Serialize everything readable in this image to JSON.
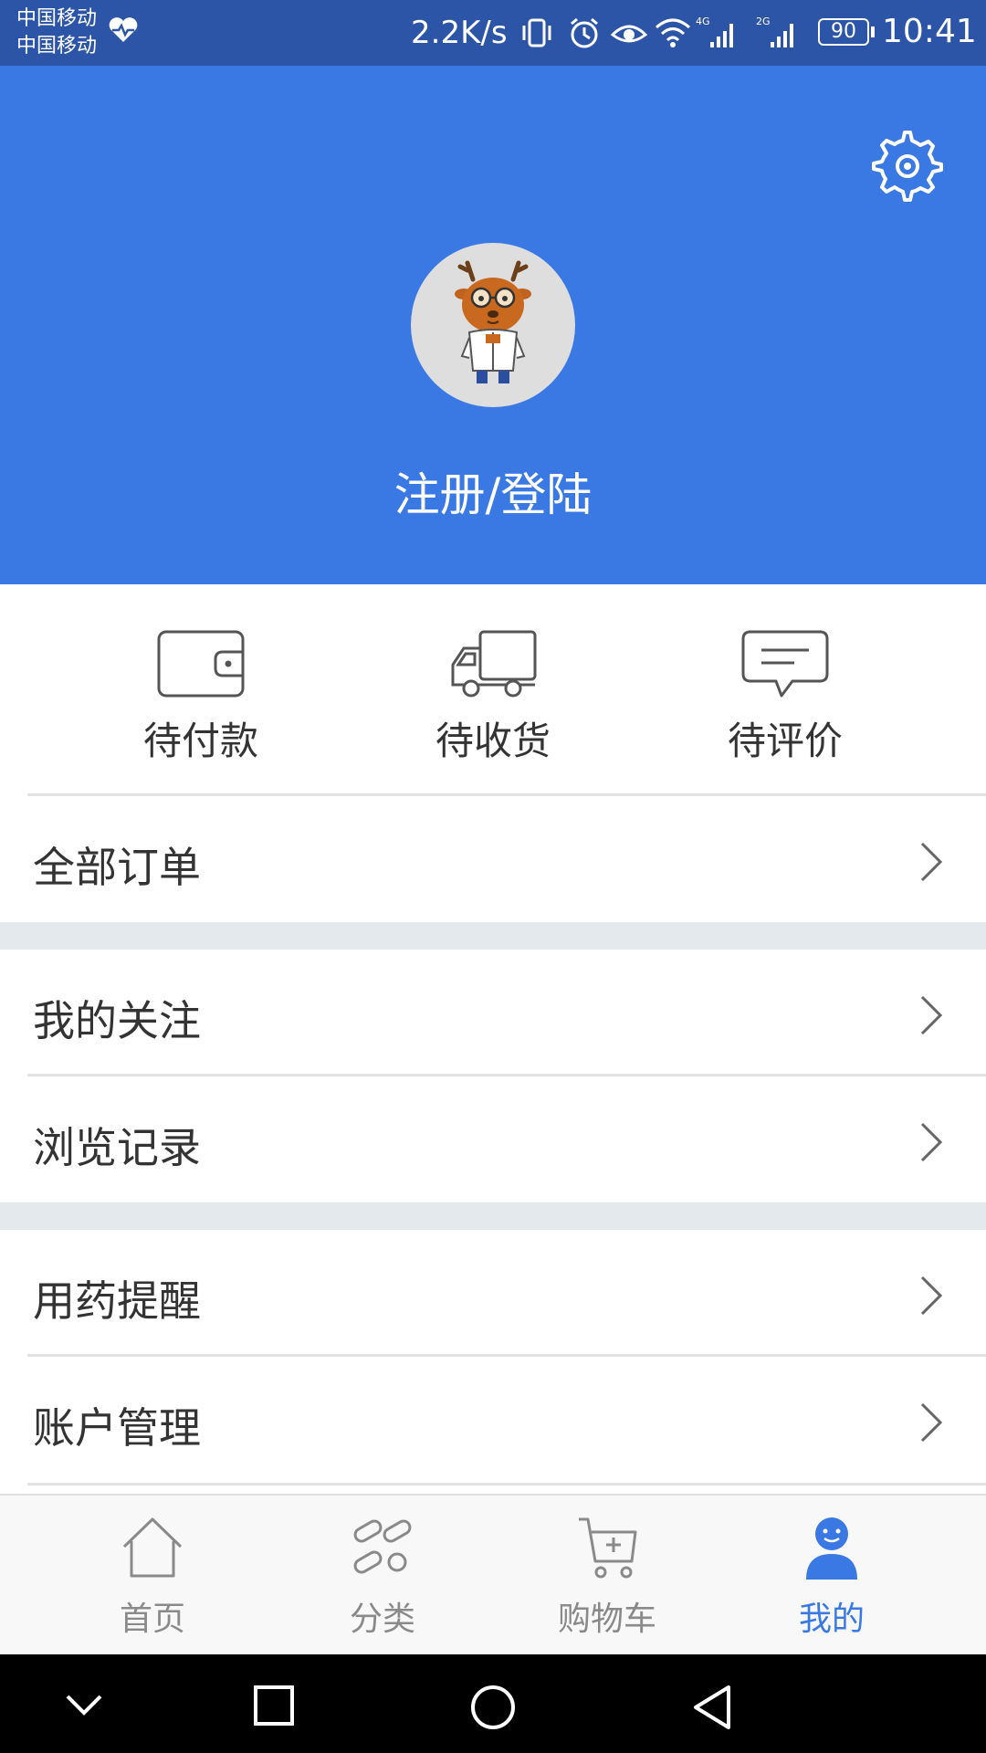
{
  "status_bar": {
    "carrier_1": "中国移动",
    "carrier_2": "中国移动",
    "net_speed": "2.2K/s",
    "battery": "90",
    "time": "10:41",
    "icons": [
      "health-icon",
      "vibrate-icon",
      "alarm-icon",
      "eye-icon",
      "wifi-icon",
      "signal-4g-icon",
      "signal-2g-icon",
      "battery-icon"
    ]
  },
  "header": {
    "background_color": "#3a79e4",
    "login_label": "注册/登陆",
    "icons": [
      "settings-icon",
      "avatar-deer-icon"
    ]
  },
  "orders": {
    "items": [
      {
        "label": "待付款",
        "icon": "wallet-icon"
      },
      {
        "label": "待收货",
        "icon": "truck-icon"
      },
      {
        "label": "待评价",
        "icon": "comment-icon"
      }
    ]
  },
  "menu": {
    "all_orders": "全部订单",
    "my_follows": "我的关注",
    "browse_history": "浏览记录",
    "medication_reminder": "用药提醒",
    "account_management": "账户管理"
  },
  "bottom_nav": {
    "active_color": "#3a79e4",
    "items": [
      {
        "label": "首页",
        "icon": "home-icon"
      },
      {
        "label": "分类",
        "icon": "category-icon"
      },
      {
        "label": "购物车",
        "icon": "cart-icon"
      },
      {
        "label": "我的",
        "icon": "profile-icon",
        "active": true
      }
    ]
  },
  "system_nav": {
    "icons": [
      "collapse-icon",
      "recents-icon",
      "home-circle-icon",
      "back-icon"
    ]
  }
}
